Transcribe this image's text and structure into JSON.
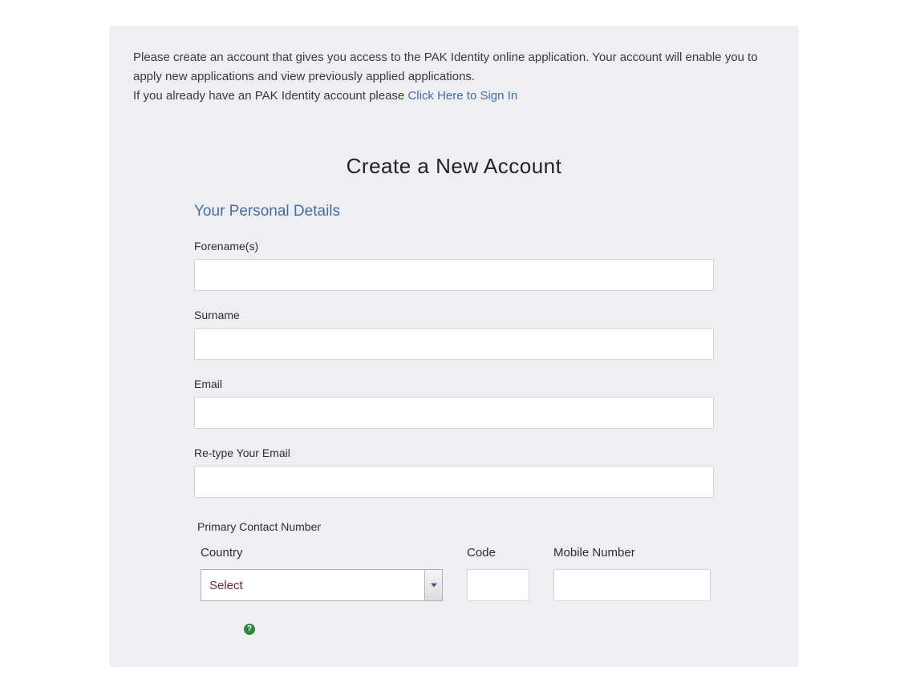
{
  "intro": {
    "line1": "Please create an account that gives you access to the PAK Identity online application. Your account will enable you to apply new applications and view previously applied applications.",
    "line2_prefix": "If you already have an PAK Identity account please ",
    "signin_link": "Click Here to Sign In"
  },
  "title": "Create a New Account",
  "section_title": "Your Personal Details",
  "fields": {
    "forename_label": "Forename(s)",
    "surname_label": "Surname",
    "email_label": "Email",
    "retype_email_label": "Re-type Your Email"
  },
  "primary_contact_label": "Primary Contact Number",
  "phone": {
    "country_label": "Country",
    "country_selected": "Select",
    "code_label": "Code",
    "mobile_label": "Mobile Number"
  },
  "help_icon_glyph": "?"
}
